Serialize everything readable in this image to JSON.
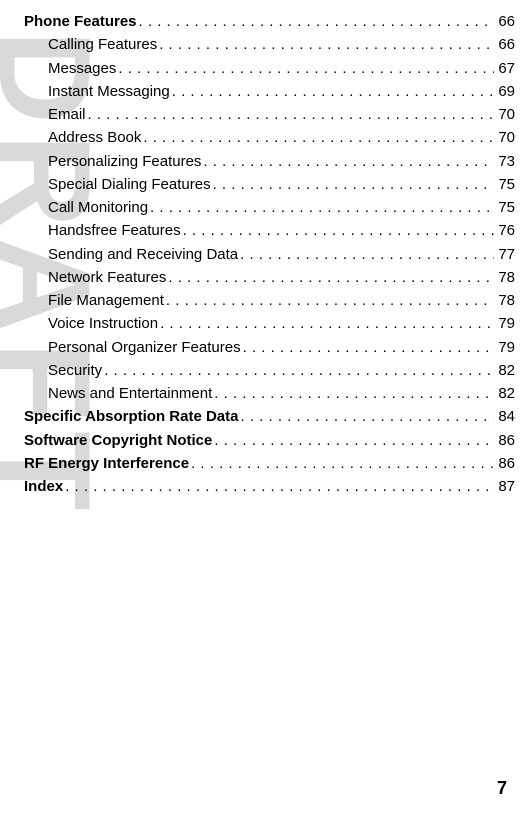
{
  "watermark": "DRAFT",
  "toc": [
    {
      "title": "Phone Features",
      "page": "66",
      "bold": true,
      "indent": false
    },
    {
      "title": "Calling Features",
      "page": "66",
      "bold": false,
      "indent": true
    },
    {
      "title": "Messages",
      "page": "67",
      "bold": false,
      "indent": true
    },
    {
      "title": "Instant Messaging",
      "page": "69",
      "bold": false,
      "indent": true
    },
    {
      "title": "Email",
      "page": "70",
      "bold": false,
      "indent": true
    },
    {
      "title": "Address Book",
      "page": "70",
      "bold": false,
      "indent": true
    },
    {
      "title": "Personalizing Features",
      "page": "73",
      "bold": false,
      "indent": true
    },
    {
      "title": "Special Dialing Features",
      "page": "75",
      "bold": false,
      "indent": true
    },
    {
      "title": "Call Monitoring",
      "page": "75",
      "bold": false,
      "indent": true
    },
    {
      "title": "Handsfree Features",
      "page": "76",
      "bold": false,
      "indent": true
    },
    {
      "title": "Sending and Receiving Data",
      "page": "77",
      "bold": false,
      "indent": true
    },
    {
      "title": "Network Features",
      "page": "78",
      "bold": false,
      "indent": true
    },
    {
      "title": "File Management",
      "page": "78",
      "bold": false,
      "indent": true
    },
    {
      "title": "Voice Instruction",
      "page": "79",
      "bold": false,
      "indent": true
    },
    {
      "title": "Personal Organizer Features",
      "page": "79",
      "bold": false,
      "indent": true
    },
    {
      "title": "Security",
      "page": "82",
      "bold": false,
      "indent": true
    },
    {
      "title": "News and Entertainment",
      "page": "82",
      "bold": false,
      "indent": true
    },
    {
      "title": "Specific Absorption Rate Data",
      "page": "84",
      "bold": true,
      "indent": false
    },
    {
      "title": "Software Copyright Notice",
      "page": "86",
      "bold": true,
      "indent": false
    },
    {
      "title": "RF Energy Interference",
      "page": "86",
      "bold": true,
      "indent": false
    },
    {
      "title": "Index",
      "page": "87",
      "bold": true,
      "indent": false
    }
  ],
  "page_number": "7"
}
